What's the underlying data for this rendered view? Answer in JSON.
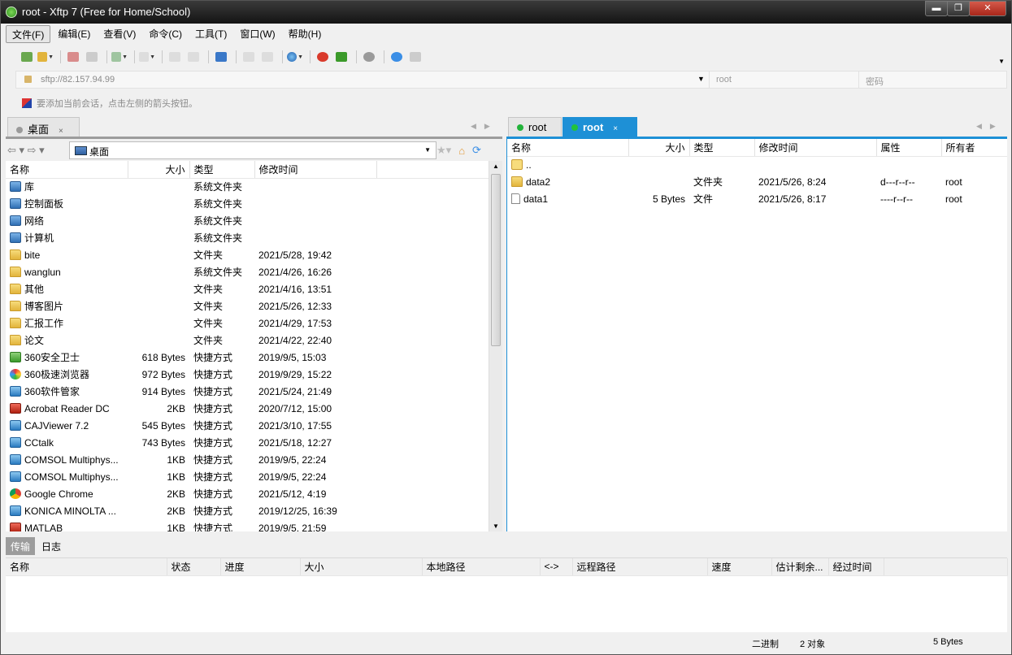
{
  "window": {
    "title": "root - Xftp 7 (Free for Home/School)",
    "minimize": "▬",
    "maximize": "❐",
    "close": "✕"
  },
  "menu": [
    "文件(F)",
    "编辑(E)",
    "查看(V)",
    "命令(C)",
    "工具(T)",
    "窗口(W)",
    "帮助(H)"
  ],
  "address": {
    "url": "sftp://82.157.94.99",
    "user_placeholder": "root",
    "pass_placeholder": "密码"
  },
  "hint": "要添加当前会话，点击左侧的箭头按钮。",
  "local": {
    "tab_label": "桌面",
    "tab_close": "×",
    "path": "桌面",
    "columns": [
      "名称",
      "大小",
      "类型",
      "修改时间"
    ],
    "rows": [
      {
        "icon": "library-icon",
        "name": "库",
        "size": "",
        "type": "系统文件夹",
        "mtime": ""
      },
      {
        "icon": "control-panel-icon",
        "name": "控制面板",
        "size": "",
        "type": "系统文件夹",
        "mtime": ""
      },
      {
        "icon": "network-icon",
        "name": "网络",
        "size": "",
        "type": "系统文件夹",
        "mtime": ""
      },
      {
        "icon": "computer-icon",
        "name": "计算机",
        "size": "",
        "type": "系统文件夹",
        "mtime": ""
      },
      {
        "icon": "folder-icon",
        "name": "bite",
        "size": "",
        "type": "文件夹",
        "mtime": "2021/5/28, 19:42"
      },
      {
        "icon": "user-folder-icon",
        "name": "wanglun",
        "size": "",
        "type": "系统文件夹",
        "mtime": "2021/4/26, 16:26"
      },
      {
        "icon": "folder-icon",
        "name": "其他",
        "size": "",
        "type": "文件夹",
        "mtime": "2021/4/16, 13:51"
      },
      {
        "icon": "folder-icon",
        "name": "博客图片",
        "size": "",
        "type": "文件夹",
        "mtime": "2021/5/26, 12:33"
      },
      {
        "icon": "folder-icon",
        "name": "汇报工作",
        "size": "",
        "type": "文件夹",
        "mtime": "2021/4/29, 17:53"
      },
      {
        "icon": "folder-icon",
        "name": "论文",
        "size": "",
        "type": "文件夹",
        "mtime": "2021/4/22, 22:40"
      },
      {
        "icon": "360-icon",
        "name": "360安全卫士",
        "size": "618 Bytes",
        "type": "快捷方式",
        "mtime": "2019/9/5, 15:03"
      },
      {
        "icon": "browser-icon",
        "name": "360极速浏览器",
        "size": "972 Bytes",
        "type": "快捷方式",
        "mtime": "2019/9/29, 15:22"
      },
      {
        "icon": "360-soft-icon",
        "name": "360软件管家",
        "size": "914 Bytes",
        "type": "快捷方式",
        "mtime": "2021/5/24, 21:49"
      },
      {
        "icon": "acrobat-icon",
        "name": "Acrobat Reader DC",
        "size": "2KB",
        "type": "快捷方式",
        "mtime": "2020/7/12, 15:00"
      },
      {
        "icon": "caj-icon",
        "name": "CAJViewer 7.2",
        "size": "545 Bytes",
        "type": "快捷方式",
        "mtime": "2021/3/10, 17:55"
      },
      {
        "icon": "cctalk-icon",
        "name": "CCtalk",
        "size": "743 Bytes",
        "type": "快捷方式",
        "mtime": "2021/5/18, 12:27"
      },
      {
        "icon": "comsol-icon",
        "name": "COMSOL Multiphys...",
        "size": "1KB",
        "type": "快捷方式",
        "mtime": "2019/9/5, 22:24"
      },
      {
        "icon": "comsol-icon",
        "name": "COMSOL Multiphys...",
        "size": "1KB",
        "type": "快捷方式",
        "mtime": "2019/9/5, 22:24"
      },
      {
        "icon": "chrome-icon",
        "name": "Google Chrome",
        "size": "2KB",
        "type": "快捷方式",
        "mtime": "2021/5/12, 4:19"
      },
      {
        "icon": "konica-icon",
        "name": "KONICA MINOLTA ...",
        "size": "2KB",
        "type": "快捷方式",
        "mtime": "2019/12/25, 16:39"
      },
      {
        "icon": "matlab-icon",
        "name": "MATLAB",
        "size": "1KB",
        "type": "快捷方式",
        "mtime": "2019/9/5, 21:59"
      }
    ]
  },
  "remote": {
    "tabs": [
      {
        "label": "root"
      },
      {
        "label": "root",
        "close": "×"
      }
    ],
    "columns": [
      "名称",
      "大小",
      "类型",
      "修改时间",
      "属性",
      "所有者"
    ],
    "rows": [
      {
        "icon": "parent-folder-icon",
        "name": "..",
        "size": "",
        "type": "",
        "mtime": "",
        "attr": "",
        "owner": ""
      },
      {
        "icon": "folder-icon",
        "name": "data2",
        "size": "",
        "type": "文件夹",
        "mtime": "2021/5/26, 8:24",
        "attr": "d---r--r--",
        "owner": "root"
      },
      {
        "icon": "file-icon",
        "name": "data1",
        "size": "5 Bytes",
        "type": "文件",
        "mtime": "2021/5/26, 8:17",
        "attr": "----r--r--",
        "owner": "root"
      }
    ]
  },
  "bottom": {
    "tabs": [
      "传输",
      "日志"
    ],
    "columns": [
      "名称",
      "状态",
      "进度",
      "大小",
      "本地路径",
      "<->",
      "远程路径",
      "速度",
      "估计剩余...",
      "经过时间"
    ]
  },
  "status": {
    "mode": "二进制",
    "objects": "2 对象",
    "size": "5 Bytes"
  }
}
